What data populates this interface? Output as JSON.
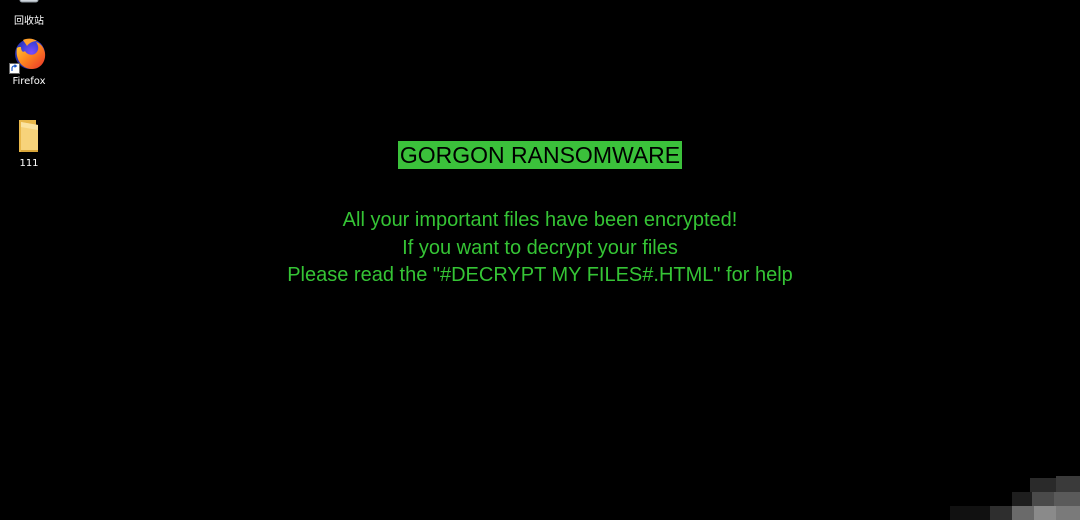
{
  "desktop": {
    "background_color": "#000000",
    "icons": [
      {
        "name": "top-icon",
        "label": "回收站",
        "icon": "recycle-bin-icon"
      },
      {
        "name": "firefox",
        "label": "Firefox",
        "icon": "firefox-icon"
      },
      {
        "name": "folder",
        "label": "111",
        "icon": "folder-icon"
      }
    ]
  },
  "ransom_note": {
    "title": "GORGON RANSOMWARE",
    "lines": [
      "All your important files have been encrypted!",
      "If you want to decrypt your files",
      "Please read the \"#DECRYPT MY FILES#.HTML\" for help"
    ],
    "title_background": "#3bc13b",
    "text_color": "#35c435"
  }
}
